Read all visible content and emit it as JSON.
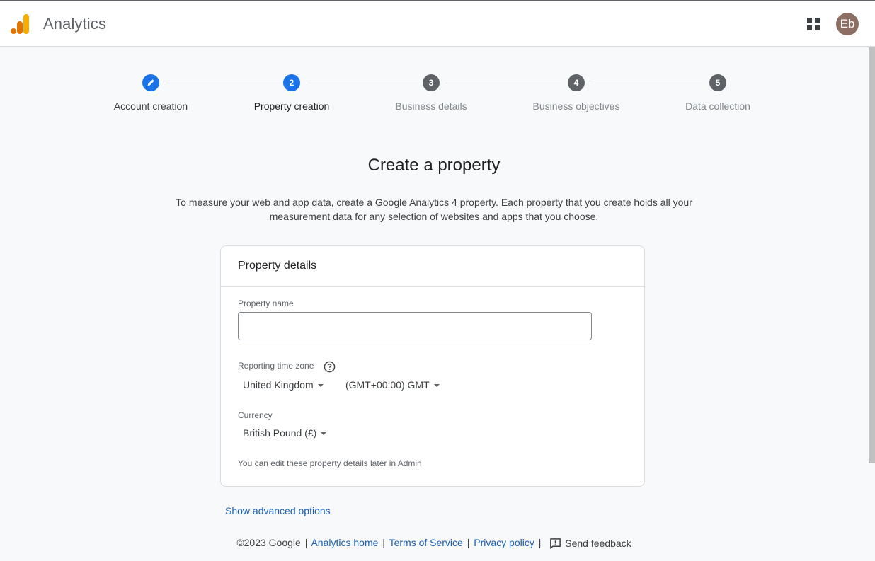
{
  "header": {
    "app_title": "Analytics",
    "apps_icon": "apps-grid-icon",
    "avatar_initials": "Eb",
    "avatar_color": "#8d6e63"
  },
  "stepper": {
    "steps": [
      {
        "label": "Account creation",
        "marker": "",
        "state": "done",
        "icon": "pencil-icon"
      },
      {
        "label": "Property creation",
        "marker": "2",
        "state": "current"
      },
      {
        "label": "Business details",
        "marker": "3",
        "state": "pending"
      },
      {
        "label": "Business objectives",
        "marker": "4",
        "state": "pending"
      },
      {
        "label": "Data collection",
        "marker": "5",
        "state": "pending"
      }
    ],
    "active_color": "#1a73e8",
    "pending_color": "#5f6368"
  },
  "main": {
    "title": "Create a property",
    "intro_line1": "To measure your web and app data, create a Google Analytics 4 property. Each property that you create holds all your",
    "intro_line2": "measurement data for any selection of websites and apps that you choose."
  },
  "card": {
    "header": "Property details",
    "property_name_label": "Property name",
    "property_name_value": "",
    "timezone_label": "Reporting time zone",
    "timezone_country": "United Kingdom",
    "timezone_value": "(GMT+00:00) GMT",
    "currency_label": "Currency",
    "currency_value": "British Pound (£)",
    "note": "You can edit these property details later in Admin"
  },
  "advanced_link": "Show advanced options",
  "footer": {
    "copyright": "©2023 Google",
    "links": [
      "Analytics home",
      "Terms of Service",
      "Privacy policy"
    ],
    "separator": "|",
    "feedback": "Send feedback"
  }
}
